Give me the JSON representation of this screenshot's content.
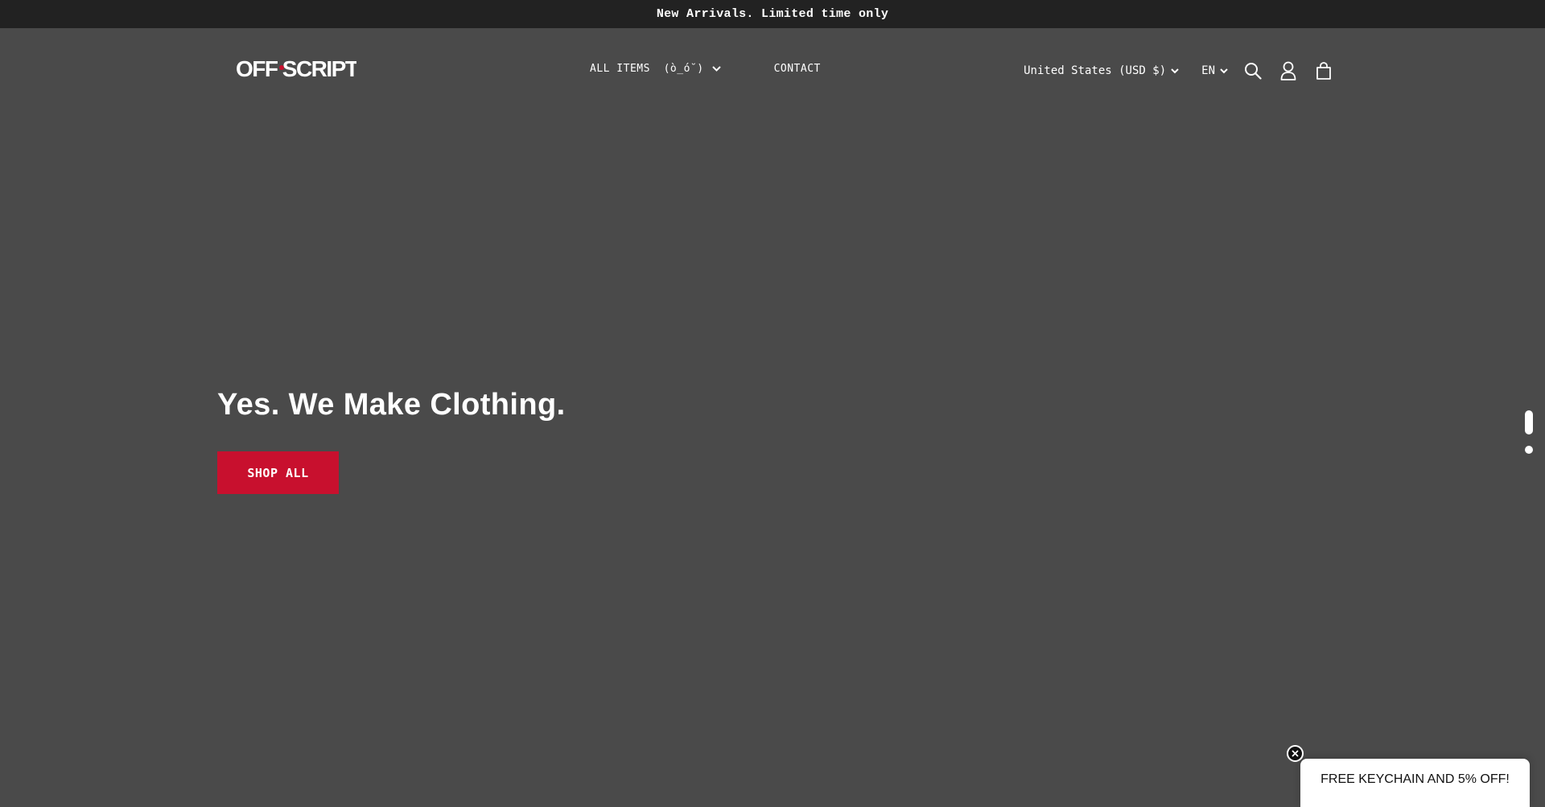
{
  "announcement": {
    "text": "New Arrivals. Limited time only"
  },
  "header": {
    "logo_text": "OFF SCRIPT",
    "nav": [
      {
        "label": "ALL ITEMS  (ò_ó˘)",
        "has_dropdown": true
      },
      {
        "label": "CONTACT",
        "has_dropdown": false
      }
    ],
    "country_selector": "United States (USD $)",
    "language_selector": "EN",
    "icons": [
      "search-icon",
      "account-icon",
      "cart-icon"
    ]
  },
  "hero": {
    "title": "Yes. We Make Clothing.",
    "cta_label": "SHOP ALL",
    "slides_total": 2,
    "active_slide": 1
  },
  "promo": {
    "text": "FREE KEYCHAIN AND 5% OFF!"
  },
  "colors": {
    "page_bg": "#4a4a4a",
    "announcement_bg": "#222222",
    "accent": "#c8102e",
    "text": "#ffffff"
  }
}
